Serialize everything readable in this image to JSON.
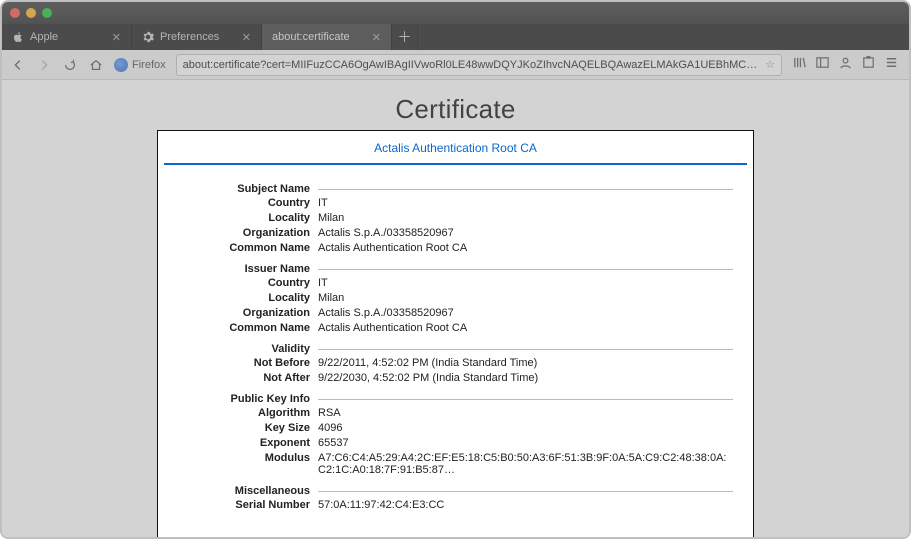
{
  "window": {
    "traffic": [
      "close",
      "minimize",
      "zoom"
    ]
  },
  "tabs": [
    {
      "label": "Apple",
      "icon": "apple-icon",
      "active": false
    },
    {
      "label": "Preferences",
      "icon": "gear-icon",
      "active": false
    },
    {
      "label": "about:certificate",
      "icon": "",
      "active": true
    }
  ],
  "nav": {
    "firefox_label": "Firefox",
    "url": "about:certificate?cert=MIIFuzCCA6OgAwIBAgIIVwoRl0LE48wwDQYJKoZIhvcNAQELBQAwazELMAkGA1UEBhMCSVQx"
  },
  "page": {
    "title": "Certificate",
    "cert_tab": "Actalis Authentication Root CA"
  },
  "sections": [
    {
      "title": "Subject Name",
      "rows": [
        {
          "label": "Country",
          "value": "IT"
        },
        {
          "label": "Locality",
          "value": "Milan"
        },
        {
          "label": "Organization",
          "value": "Actalis S.p.A./03358520967"
        },
        {
          "label": "Common Name",
          "value": "Actalis Authentication Root CA"
        }
      ]
    },
    {
      "title": "Issuer Name",
      "rows": [
        {
          "label": "Country",
          "value": "IT"
        },
        {
          "label": "Locality",
          "value": "Milan"
        },
        {
          "label": "Organization",
          "value": "Actalis S.p.A./03358520967"
        },
        {
          "label": "Common Name",
          "value": "Actalis Authentication Root CA"
        }
      ]
    },
    {
      "title": "Validity",
      "rows": [
        {
          "label": "Not Before",
          "value": "9/22/2011, 4:52:02 PM (India Standard Time)"
        },
        {
          "label": "Not After",
          "value": "9/22/2030, 4:52:02 PM (India Standard Time)"
        }
      ]
    },
    {
      "title": "Public Key Info",
      "rows": [
        {
          "label": "Algorithm",
          "value": "RSA"
        },
        {
          "label": "Key Size",
          "value": "4096"
        },
        {
          "label": "Exponent",
          "value": "65537"
        },
        {
          "label": "Modulus",
          "value": "A7:C6:C4:A5:29:A4:2C:EF:E5:18:C5:B0:50:A3:6F:51:3B:9F:0A:5A:C9:C2:48:38:0A:C2:1C:A0:18:7F:91:B5:87…"
        }
      ]
    },
    {
      "title": "Miscellaneous",
      "rows": [
        {
          "label": "Serial Number",
          "value": "57:0A:11:97:42:C4:E3:CC"
        }
      ]
    }
  ]
}
